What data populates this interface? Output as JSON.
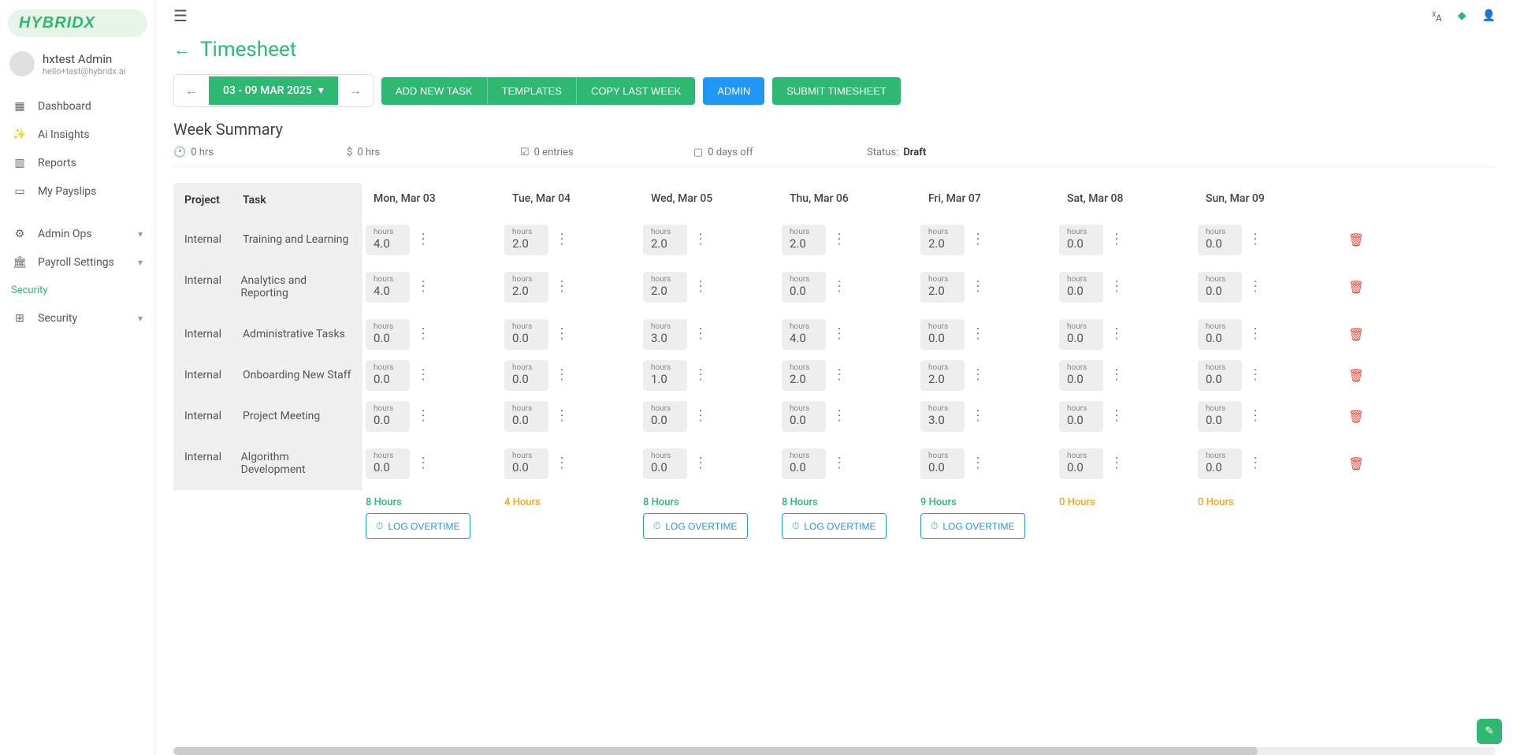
{
  "logo": "HYBRIDX",
  "user": {
    "name": "hxtest Admin",
    "email": "hello+test@hybridx.ai"
  },
  "nav": {
    "dashboard": "Dashboard",
    "insights": "Ai Insights",
    "reports": "Reports",
    "payslips": "My Payslips",
    "adminops": "Admin Ops",
    "payroll": "Payroll Settings",
    "security_sub": "Security",
    "security": "Security"
  },
  "page_title": "Timesheet",
  "date_range": "03 - 09 MAR 2025",
  "buttons": {
    "add_task": "ADD NEW TASK",
    "templates": "TEMPLATES",
    "copy": "COPY LAST WEEK",
    "admin": "ADMIN",
    "submit": "SUBMIT TIMESHEET",
    "log_ot": "LOG OVERTIME"
  },
  "summary": {
    "title": "Week Summary",
    "hours": "0 hrs",
    "cost": "0 hrs",
    "entries": "0 entries",
    "daysoff": "0 days off",
    "status_label": "Status: ",
    "status_value": "Draft"
  },
  "headers": {
    "project": "Project",
    "task": "Task",
    "days": [
      "Mon, Mar 03",
      "Tue, Mar 04",
      "Wed, Mar 05",
      "Thu, Mar 06",
      "Fri, Mar 07",
      "Sat, Mar 08",
      "Sun, Mar 09"
    ]
  },
  "hours_label": "hours",
  "rows": [
    {
      "project": "Internal",
      "task": "Training and Learning",
      "vals": [
        "4.0",
        "2.0",
        "2.0",
        "2.0",
        "2.0",
        "0.0",
        "0.0"
      ]
    },
    {
      "project": "Internal",
      "task": "Analytics and Reporting",
      "vals": [
        "4.0",
        "2.0",
        "2.0",
        "0.0",
        "2.0",
        "0.0",
        "0.0"
      ]
    },
    {
      "project": "Internal",
      "task": "Administrative Tasks",
      "vals": [
        "0.0",
        "0.0",
        "3.0",
        "4.0",
        "0.0",
        "0.0",
        "0.0"
      ]
    },
    {
      "project": "Internal",
      "task": "Onboarding New Staff",
      "vals": [
        "0.0",
        "0.0",
        "1.0",
        "2.0",
        "2.0",
        "0.0",
        "0.0"
      ]
    },
    {
      "project": "Internal",
      "task": "Project Meeting",
      "vals": [
        "0.0",
        "0.0",
        "0.0",
        "0.0",
        "3.0",
        "0.0",
        "0.0"
      ]
    },
    {
      "project": "Internal",
      "task": "Algorithm Development",
      "vals": [
        "0.0",
        "0.0",
        "0.0",
        "0.0",
        "0.0",
        "0.0",
        "0.0"
      ]
    }
  ],
  "totals": [
    {
      "text": "8 Hours",
      "color": "green",
      "ot": true
    },
    {
      "text": "4 Hours",
      "color": "orange",
      "ot": false
    },
    {
      "text": "8 Hours",
      "color": "green",
      "ot": true
    },
    {
      "text": "8 Hours",
      "color": "green",
      "ot": true
    },
    {
      "text": "9 Hours",
      "color": "green",
      "ot": true
    },
    {
      "text": "0 Hours",
      "color": "orange",
      "ot": false
    },
    {
      "text": "0 Hours",
      "color": "orange",
      "ot": false
    }
  ]
}
